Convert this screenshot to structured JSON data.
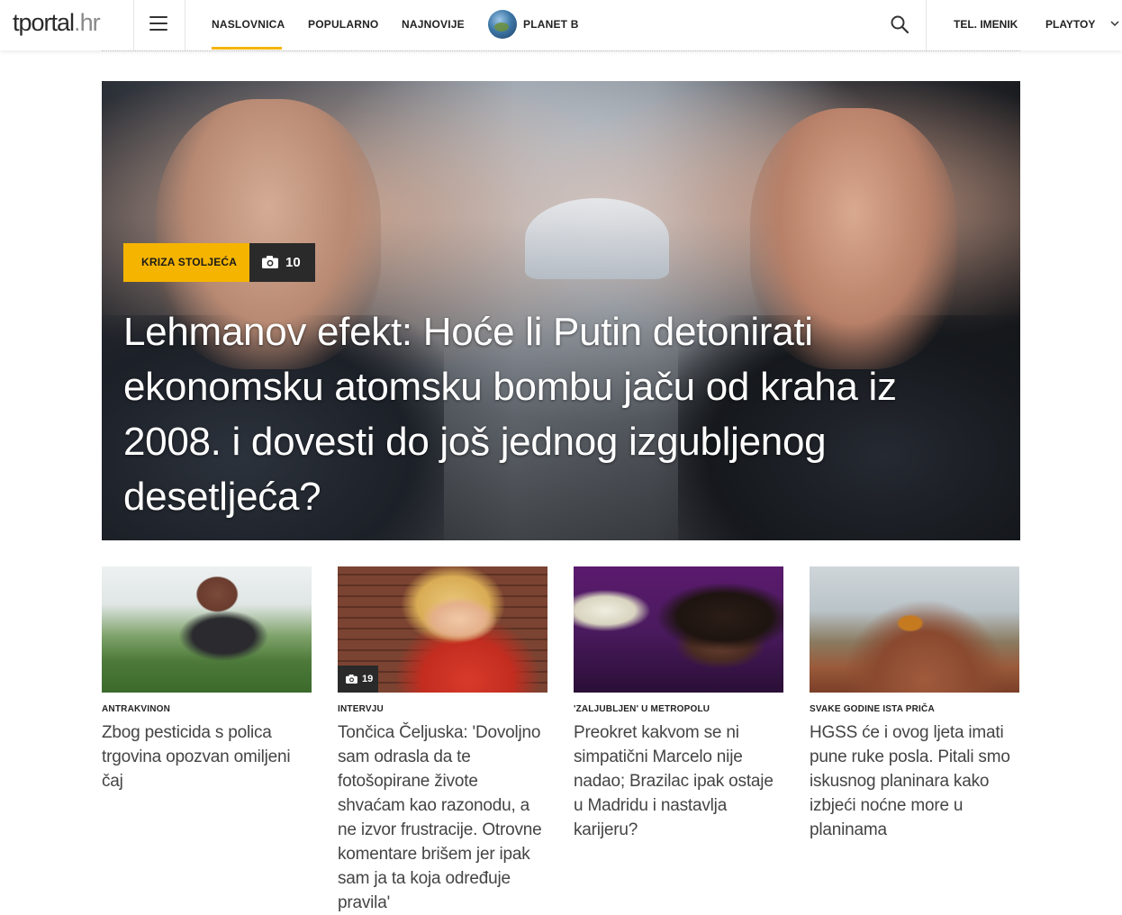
{
  "header": {
    "logo_main": "tportal",
    "logo_dot": ".",
    "logo_tld": "hr",
    "nav": [
      {
        "label": "NASLOVNICA",
        "active": true
      },
      {
        "label": "POPULARNO"
      },
      {
        "label": "NAJNOVIJE"
      },
      {
        "label": "PLANET B",
        "icon": "globe-icon"
      }
    ],
    "right_nav": [
      {
        "label": "TEL. IMENIK"
      },
      {
        "label": "PLAYTOY",
        "icon": "chevron-down-icon"
      }
    ],
    "accent_color": "#f5b400"
  },
  "hero": {
    "category": "KRIZA STOLJEĆA",
    "gallery_count": "10",
    "title": "Lehmanov efekt: Hoće li Putin detonirati ekonomsku atomsku bombu jaču od kraha iz 2008. i dovesti do još jednog izgubljenog desetljeća?"
  },
  "cards": [
    {
      "category": "ANTRAKVINON",
      "title": "Zbog pesticida s polica trgovina opozvan omiljeni čaj"
    },
    {
      "category": "INTERVJU",
      "title": "Tončica Čeljuska: 'Dovoljno sam odrasla da te fotošopirane živote shvaćam kao razonodu, a ne izvor frustracije. Otrovne komentare brišem jer ipak sam ja ta koja određuje pravila'",
      "gallery_count": "19"
    },
    {
      "category": "'ZALJUBLJEN' U METROPOLU",
      "title": "Preokret kakvom se ni simpatični Marcelo nije nadao; Brazilac ipak ostaje u Madridu i nastavlja karijeru?"
    },
    {
      "category": "SVAKE GODINE ISTA PRIČA",
      "title": "HGSS će i ovog ljeta imati pune ruke posla. Pitali smo iskusnog planinara kako izbjeći noćne more u planinama"
    }
  ]
}
